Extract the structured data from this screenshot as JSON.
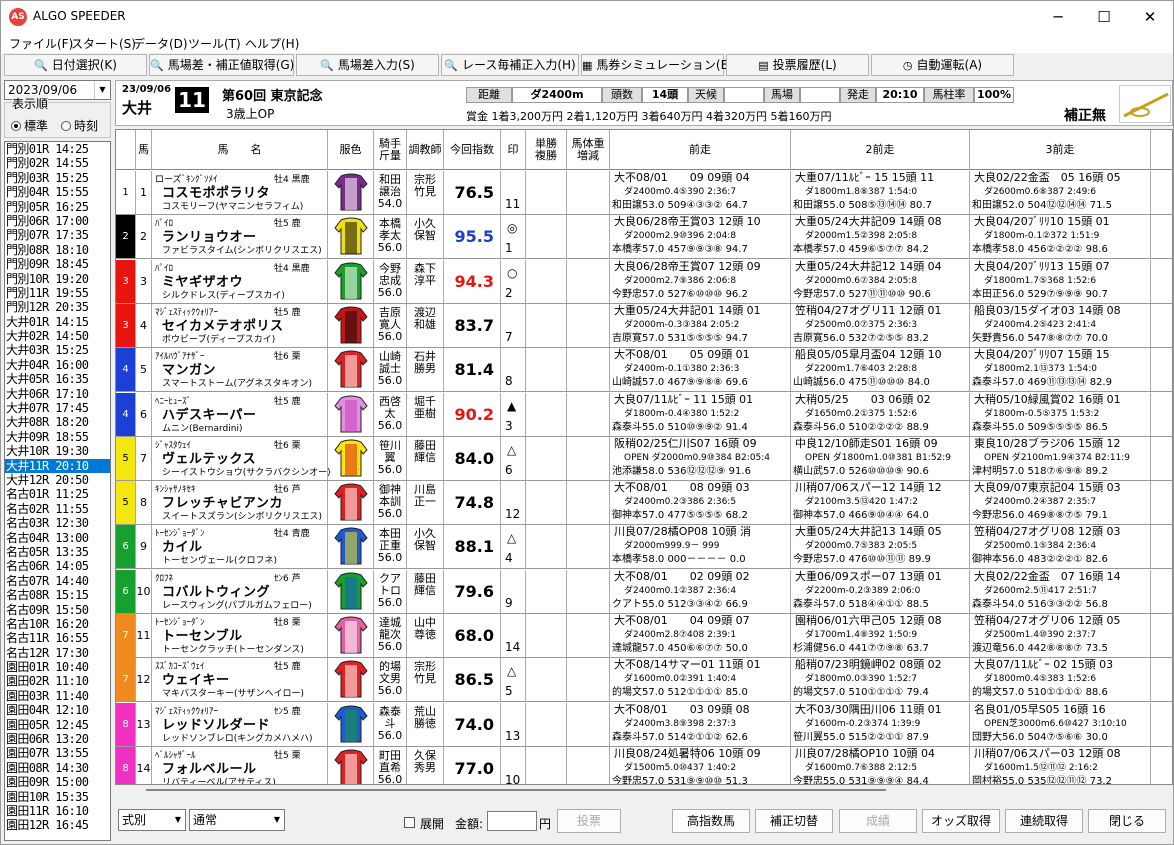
{
  "app": {
    "title": "ALGO SPEEDER",
    "icon": "algo-speeder-logo-icon"
  },
  "window": {
    "minimize": "─",
    "maximize": "☐",
    "close": "✕"
  },
  "menu": [
    "ファイル(F)",
    "スタート(S)",
    "データ(D)",
    "ツール(T)",
    "ヘルプ(H)"
  ],
  "toolbar": [
    "日付選択(K)",
    "馬場差・補正値取得(G)",
    "馬場差入力(S)",
    "レース毎補正入力(H)",
    "馬券シミュレーション(B)",
    "投票履歴(L)",
    "自動運転(A)"
  ],
  "sidebar": {
    "date": "2023/09/06",
    "display_label": "表示順",
    "radio_standard": "標準",
    "radio_time": "時刻",
    "races": [
      "門別01R 14:25",
      "門別02R 14:55",
      "門別03R 15:25",
      "門別04R 15:55",
      "門別05R 16:25",
      "門別06R 17:00",
      "門別07R 17:35",
      "門別08R 18:10",
      "門別09R 18:45",
      "門別10R 19:20",
      "門別11R 19:55",
      "門別12R 20:35",
      "大井01R 14:15",
      "大井02R 14:50",
      "大井03R 15:25",
      "大井04R 16:00",
      "大井05R 16:35",
      "大井06R 17:10",
      "大井07R 17:45",
      "大井08R 18:20",
      "大井09R 18:55",
      "大井10R 19:30",
      "大井11R 20:10",
      "大井12R 20:50",
      "名古01R 11:25",
      "名古02R 11:55",
      "名古03R 12:30",
      "名古04R 13:00",
      "名古05R 13:35",
      "名古06R 14:05",
      "名古07R 14:40",
      "名古08R 15:15",
      "名古09R 15:50",
      "名古10R 16:20",
      "名古11R 16:55",
      "名古12R 17:30",
      "園田01R 10:40",
      "園田02R 11:10",
      "園田03R 11:40",
      "園田04R 12:10",
      "園田05R 12:45",
      "園田06R 13:20",
      "園田07R 13:55",
      "園田08R 14:30",
      "園田09R 15:00",
      "園田10R 15:35",
      "園田11R 16:10",
      "園田12R 16:45"
    ],
    "selected_index": 22
  },
  "race": {
    "date": "23/09/06",
    "venue": "大井",
    "number": "11",
    "name": "第60回 東京記念",
    "class": "3歳上OP",
    "distance_label": "距離",
    "distance": "ダ2400m",
    "heads_label": "頭数",
    "heads": "14頭",
    "weather_label": "天候",
    "weather": "",
    "going_label": "馬場",
    "going": "",
    "start_label": "発走",
    "start": "20:10",
    "rate_label": "馬柱率",
    "rate": "100%",
    "prize": "賞金 1着3,200万円 2着1,120万円 3着640万円 4着320万円 5着160万円",
    "correction": "補正無"
  },
  "columns": [
    "馬",
    "馬　　名",
    "服色",
    "騎手\n斤量",
    "調教師",
    "今回指数",
    "印",
    "単勝\n複勝",
    "馬体重\n増減",
    "前走",
    "2前走",
    "3前走"
  ],
  "horses": [
    {
      "waku": "1",
      "wc": "#ffffff",
      "wt": "#000",
      "no": "1",
      "sire": "ローズﾞｷﾝｸﾞｿﾒｲ",
      "sex": "牡4 黒鹿",
      "name": "コスモポポラリタ",
      "dam": "コスモリーフ(ヤマニンセラフィム)",
      "silk": [
        "#7a2a8a",
        "#fff"
      ],
      "jockey": "和田\n譲治\n54.0",
      "trainer": "宗形\n竹見",
      "index": "76.5",
      "ic": "#000",
      "mark": "",
      "pop": "11",
      "r1": [
        "大不08/01　　09 09頭 04",
        "ダ2400m0.4⑤390 2:36:7",
        "和田譲53.0 509④③③② 64.7"
      ],
      "r2": [
        "大重07/11ﾙﾋﾞｰ 15 15頭 11",
        "ダ1800m1.8⑧387 1:54:0",
        "和田譲55.0 508⑤⑬⑭⑭ 80.7"
      ],
      "r3": [
        "大良02/22金盃　05 16頭 05",
        "ダ2600m0.6⑧387 2:49:6",
        "和田譲52.0 504⑫⑫⑭⑭ 71.5"
      ]
    },
    {
      "waku": "2",
      "wc": "#000000",
      "wt": "#fff",
      "no": "2",
      "sire": "ﾊﾟｲﾛ",
      "sex": "牡5 鹿",
      "name": "ランリョウオー",
      "dam": "ファビラスタイム(シンボリクリスエス)",
      "silk": [
        "#f2e017",
        "#111"
      ],
      "jockey": "本橋\n孝太\n56.0",
      "trainer": "小久\n保智",
      "index": "95.5",
      "ic": "#1a3ccf",
      "mark": "◎",
      "pop": "1",
      "r1": [
        "大良06/28帝王賞03 12頭 10",
        "ダ2000m2.9⑩396 2:04:8",
        "本橋孝57.0 457⑨⑨③⑧ 94.7"
      ],
      "r2": [
        "大重05/24大井記09 14頭 08",
        "ダ2000m1.5②398 2:05:8",
        "本橋孝57.0 459⑥⑤⑦⑦ 84.2"
      ],
      "r3": [
        "大良04/20ﾌﾞﾘﾘ10 15頭 01",
        "ダ1800m-0.1②372 1:51:9",
        "本橋孝58.0 456②②②② 98.6"
      ]
    },
    {
      "waku": "3",
      "wc": "#e8140f",
      "wt": "#fff",
      "no": "3",
      "sire": "ﾊﾟｲﾛ",
      "sex": "牡4 黒鹿",
      "name": "ミヤギザオウ",
      "dam": "シルクドレス(ディープスカイ)",
      "silk": [
        "#1aa02a",
        "#fff"
      ],
      "jockey": "今野\n忠成\n56.0",
      "trainer": "森下\n淳平",
      "index": "94.3",
      "ic": "#e8140f",
      "mark": "○",
      "pop": "2",
      "r1": [
        "大良06/28帝王賞07 12頭 09",
        "ダ2000m2.7⑨386 2:06:8",
        "今野忠57.0 527⑥⑩⑩⑩ 96.2"
      ],
      "r2": [
        "大重05/24大井記12 14頭 04",
        "ダ2000m0.6⑦384 2:05:8",
        "今野忠57.0 527⑪⑪⑩⑩ 90.6"
      ],
      "r3": [
        "大良04/20ﾌﾞﾘﾘ13 15頭 07",
        "ダ1800m1.7⑤368 1:52:6",
        "本田正56.0 529⑦⑨⑨⑨ 90.7"
      ]
    },
    {
      "waku": "3",
      "wc": "#e8140f",
      "wt": "#fff",
      "no": "4",
      "sire": "ﾏｼﾞｪｽﾃｨｯｸｳｫﾘｱｰ",
      "sex": "牡5 鹿",
      "name": "セイカメテオポリス",
      "dam": "ボウビーブ(ディープスカイ)",
      "silk": [
        "#c81414",
        "#111"
      ],
      "jockey": "吉原\n寛人\n56.0",
      "trainer": "渡辺\n和雄",
      "index": "83.7",
      "ic": "#000",
      "mark": "",
      "pop": "7",
      "r1": [
        "大重05/24大井記01 14頭 01",
        "ダ2000m-0.3③384 2:05:2",
        "吉原寛57.0 531⑤⑤⑤⑤ 94.7"
      ],
      "r2": [
        "笠稍04/27オグリ11 12頭 01",
        "ダ2500m0.0⑦375 2:36:3",
        "吉原寛56.0 532⑦②⑤⑤ 83.2"
      ],
      "r3": [
        "船良03/15ダイオ03 14頭 08",
        "ダ2400m4.2⑤423 2:41:4",
        "矢野貴56.0 547⑧⑧⑦⑦ 70.0"
      ]
    },
    {
      "waku": "4",
      "wc": "#1c3fd6",
      "wt": "#fff",
      "no": "5",
      "sire": "ｱｲﾙﾊｳﾞｱﾅｻﾞｰ",
      "sex": "牡6 栗",
      "name": "マンガン",
      "dam": "スマートストーム(アグネスタキオン)",
      "silk": [
        "#e02020",
        "#fff"
      ],
      "jockey": "山崎\n誠士\n56.0",
      "trainer": "石井\n勝男",
      "index": "81.4",
      "ic": "#000",
      "mark": "",
      "pop": "8",
      "r1": [
        "大不08/01　　05 09頭 01",
        "ダ2400m-0.1①380 2:36:3",
        "山崎誠57.0 467⑨⑨⑧⑧ 69.6"
      ],
      "r2": [
        "船良05/05皐月盃04 12頭 10",
        "ダ2200m1.7⑥403 2:28:8",
        "山崎誠56.0 475⑪⑩⑩⑩ 84.0"
      ],
      "r3": [
        "大良04/20ﾌﾞﾘﾘ07 15頭 15",
        "ダ1800m2.1⑬373 1:54:0",
        "森泰斗57.0 469⑪⑬⑬⑭ 82.9"
      ]
    },
    {
      "waku": "4",
      "wc": "#1c3fd6",
      "wt": "#fff",
      "no": "6",
      "sire": "ﾍﾆｰﾋｭｰｽﾞ",
      "sex": "牡5 鹿",
      "name": "ハデスキーパー",
      "dam": "ムニン(Bernardini)",
      "silk": [
        "#e090e0",
        "#d040c0"
      ],
      "jockey": "西啓\n太\n56.0",
      "trainer": "堀千\n亜樹",
      "index": "90.2",
      "ic": "#e8140f",
      "mark": "▲",
      "pop": "3",
      "r1": [
        "大良07/11ﾙﾋﾞｰ 11 15頭 01",
        "ダ1800m-0.4④380 1:52:2",
        "森泰斗55.0 510⑩⑨⑨② 91.4"
      ],
      "r2": [
        "大稍05/25　　03 06頭 02",
        "ダ1650m0.2①375 1:52:6",
        "森泰斗56.0 510②②②② 88.9"
      ],
      "r3": [
        "大稍05/10緑風賞02 16頭 01",
        "ダ1800m-0.5⑤375 1:53:2",
        "森泰斗55.0 509⑤⑤⑤⑤ 86.5"
      ]
    },
    {
      "waku": "5",
      "wc": "#f5e60f",
      "wt": "#000",
      "no": "7",
      "sire": "ｼﾞｬｽﾀｳｪｲ",
      "sex": "牡6 栗",
      "name": "ヴェルテックス",
      "dam": "シーイストウショウ(サクラバクシンオー)",
      "silk": [
        "#f5e60f",
        "#e02020"
      ],
      "jockey": "笹川\n翼\n56.0",
      "trainer": "藤田\n輝信",
      "index": "84.0",
      "ic": "#000",
      "mark": "△",
      "pop": "6",
      "r1": [
        "阪稍02/25仁川S07 16頭 09",
        "OPEN ダ2000m0.9⑩384 B2:05:4",
        "池添謙58.0 536⑫⑫⑫⑨ 91.6"
      ],
      "r2": [
        "中良12/10師走S01 16頭 09",
        "OPEN ダ1800m1.0⑩381 B1:52:9",
        "横山武57.0 526⑩⑩⑩⑨ 90.6"
      ],
      "r3": [
        "東良10/28ブラジ06 15頭 12",
        "OPEN ダ2100m1.9④374 B2:11:9",
        "津村明57.0 518⑦⑥⑨⑧ 89.2"
      ]
    },
    {
      "waku": "5",
      "wc": "#f5e60f",
      "wt": "#000",
      "no": "8",
      "sire": "ｷﾝｼｬｻﾉｷｾｷ",
      "sex": "牡6 芦",
      "name": "フレッチャビアンカ",
      "dam": "スイートスズラン(シンボリクリスエス)",
      "silk": [
        "#e02020",
        "#fff"
      ],
      "jockey": "御神\n本訓\n56.0",
      "trainer": "川島\n正一",
      "index": "74.8",
      "ic": "#000",
      "mark": "",
      "pop": "12",
      "r1": [
        "大不08/01　　08 09頭 03",
        "ダ2400m0.2③386 2:36:5",
        "御神本57.0 477⑤⑤⑤⑤ 68.2"
      ],
      "r2": [
        "川稍07/06スパー12 14頭 12",
        "ダ2100m3.5⑬420 1:47:2",
        "御神本57.0 466⑨⑩④④ 64.0"
      ],
      "r3": [
        "大良09/07東京記04 15頭 03",
        "ダ2400m0.2④387 2:35:7",
        "今野忠56.0 469⑧⑧⑦⑤ 79.1"
      ]
    },
    {
      "waku": "6",
      "wc": "#16a02e",
      "wt": "#fff",
      "no": "9",
      "sire": "ﾄｰｾﾝｼﾞｮｰﾀﾞﾝ",
      "sex": "牡4 青鹿",
      "name": "カイル",
      "dam": "トーセンヴェール(クロフネ)",
      "silk": [
        "#1c5ad6",
        "#f5e60f"
      ],
      "jockey": "本田\n正重\n56.0",
      "trainer": "小久\n保智",
      "index": "88.1",
      "ic": "#000",
      "mark": "△",
      "pop": "4",
      "r1": [
        "川良07/28橘OP08 10頭 消",
        "ダ2000m999.9－ 999",
        "本橋孝58.0 000－－－－ 0.0"
      ],
      "r2": [
        "大重05/24大井記13 14頭 05",
        "ダ2000m0.7⑤383 2:05:5",
        "今野忠57.0 476⑩⑩⑪⑪ 89.9"
      ],
      "r3": [
        "笠稍04/27オグリ08 12頭 03",
        "ダ2500m0.1⑤384 2:36:4",
        "御神本56.0 483②②②① 82.6"
      ]
    },
    {
      "waku": "6",
      "wc": "#16a02e",
      "wt": "#fff",
      "no": "10",
      "sire": "ｸﾛﾌﾈ",
      "sex": "ｾﾝ6 芦",
      "name": "コバルトウィング",
      "dam": "レースウィング(パブルガムフェロー)",
      "silk": [
        "#16a02e",
        "#1c5ad6"
      ],
      "jockey": "クア\nトロ\n56.0",
      "trainer": "藤田\n輝信",
      "index": "79.6",
      "ic": "#000",
      "mark": "",
      "pop": "9",
      "r1": [
        "大不08/01　　02 09頭 02",
        "ダ2400m0.1②387 2:36:4",
        "クアト55.0 512③③④② 66.9"
      ],
      "r2": [
        "大重06/09スポー07 13頭 01",
        "ダ2200m-0.2③389 2:06:0",
        "森泰斗57.0 518④④①① 88.5"
      ],
      "r3": [
        "大良02/22金盃　07 16頭 14",
        "ダ2600m2.5⑪417 2:51:7",
        "森泰斗54.0 516③③②② 56.8"
      ]
    },
    {
      "waku": "7",
      "wc": "#f08a1e",
      "wt": "#fff",
      "no": "11",
      "sire": "ﾄｰｾﾝｼﾞｮｰﾀﾞﾝ",
      "sex": "牡8 栗",
      "name": "トーセンブル",
      "dam": "トーセンクラッチ(トーセンダンス)",
      "silk": [
        "#e060a0",
        "#fff"
      ],
      "jockey": "達城\n龍次\n56.0",
      "trainer": "山中\n尊徳",
      "index": "68.0",
      "ic": "#000",
      "mark": "",
      "pop": "14",
      "r1": [
        "大不08/01　　04 09頭 07",
        "ダ2400m2.8⑦408 2:39:1",
        "達城龍57.0 450⑥⑥⑦⑦ 50.0"
      ],
      "r2": [
        "園稍06/01六甲己05 12頭 08",
        "ダ1700m1.4⑧392 1:50:9",
        "杉浦健56.0 441⑦⑦⑨⑧ 63.7"
      ],
      "r3": [
        "笠稍04/27オグリ06 12頭 05",
        "ダ2500m1.4⑩390 2:37:7",
        "渡辺竜56.0 442⑧⑧⑧⑦ 73.5"
      ]
    },
    {
      "waku": "7",
      "wc": "#f08a1e",
      "wt": "#fff",
      "no": "12",
      "sire": "ｽｽﾞｶｺｰｽﾞｳｪｲ",
      "sex": "牡5 鹿",
      "name": "ウェイキー",
      "dam": "マキバスターキー(サザンヘイロー)",
      "silk": [
        "#e02020",
        "#fff"
      ],
      "jockey": "的場\n文男\n56.0",
      "trainer": "宗形\n竹見",
      "index": "86.5",
      "ic": "#000",
      "mark": "△",
      "pop": "5",
      "r1": [
        "大不08/14サマー01 11頭 01",
        "ダ1600m0.0②391 1:40:4",
        "的場文57.0 512①①①① 85.0"
      ],
      "r2": [
        "船稍07/23明鏡岬02 08頭 02",
        "ダ1800m0.0③390 1:52:7",
        "的場文57.0 510①①①① 79.4"
      ],
      "r3": [
        "大良07/11ﾙﾋﾞｰ 02 15頭 03",
        "ダ1800m0.4⑤383 1:52:6",
        "的場文57.0 510①①①① 88.6"
      ]
    },
    {
      "waku": "8",
      "wc": "#f030c0",
      "wt": "#fff",
      "no": "13",
      "sire": "ﾏｼﾞｪｽﾃｨｯｸｳｫﾘｱｰ",
      "sex": "ｾﾝ5 鹿",
      "name": "レッドソルダード",
      "dam": "レッドソンブレロ(キングカメハメハ)",
      "silk": [
        "#1c5ad6",
        "#16a02e"
      ],
      "jockey": "森泰\n斗\n56.0",
      "trainer": "荒山\n勝徳",
      "index": "74.0",
      "ic": "#000",
      "mark": "",
      "pop": "13",
      "r1": [
        "大不08/01　　03 09頭 08",
        "ダ2400m3.8⑨398 2:37:3",
        "森泰斗57.0 514②①①② 62.6"
      ],
      "r2": [
        "大不03/30隅田川06 11頭 01",
        "ダ1600m-0.2③374 1:39:9",
        "笹川翼55.0 515②②①① 87.9"
      ],
      "r3": [
        "名良01/05早S05 16頭 16",
        "OPEN芝3000m6.6⑩427 3:10:10",
        "団野大56.0 504⑦⑤⑥⑥ 30.0"
      ]
    },
    {
      "waku": "8",
      "wc": "#f030c0",
      "wt": "#fff",
      "no": "14",
      "sire": "ﾍﾞﾙｼｬｻﾞｰﾙ",
      "sex": "牡5 栗",
      "name": "フォルベルール",
      "dam": "リバティーベル(アサティス)",
      "silk": [
        "#e02020",
        "#fff"
      ],
      "jockey": "町田\n直希\n56.0",
      "trainer": "久保\n秀男",
      "index": "77.0",
      "ic": "#000",
      "mark": "",
      "pop": "10",
      "r1": [
        "川良08/24処暑特06 10頭 09",
        "ダ1500m5.0⑩437 1:40:2",
        "今野忠57.0 531⑨⑨⑩⑩ 51.3"
      ],
      "r2": [
        "川良07/28橘OP10 10頭 04",
        "ダ1600m0.7⑥388 2:12:5",
        "今野忠55.0 531⑨⑨⑨④ 84.4"
      ],
      "r3": [
        "川稍07/06スパー03 12頭 08",
        "ダ1600m1.5⑫⑪⑫ 2:16:2",
        "岡村裕55.0 535⑫⑫⑪⑫ 73.2"
      ]
    }
  ],
  "bottom": {
    "type_sel": "式別",
    "mode_sel": "通常",
    "tenkai": "展開",
    "amount_label": "金額:",
    "amount": "",
    "yen": "円",
    "vote": "投票",
    "high_idx": "高指数馬",
    "corr": "補正切替",
    "result": "成績",
    "odds": "オッズ取得",
    "cont": "連続取得",
    "close": "閉じる"
  }
}
